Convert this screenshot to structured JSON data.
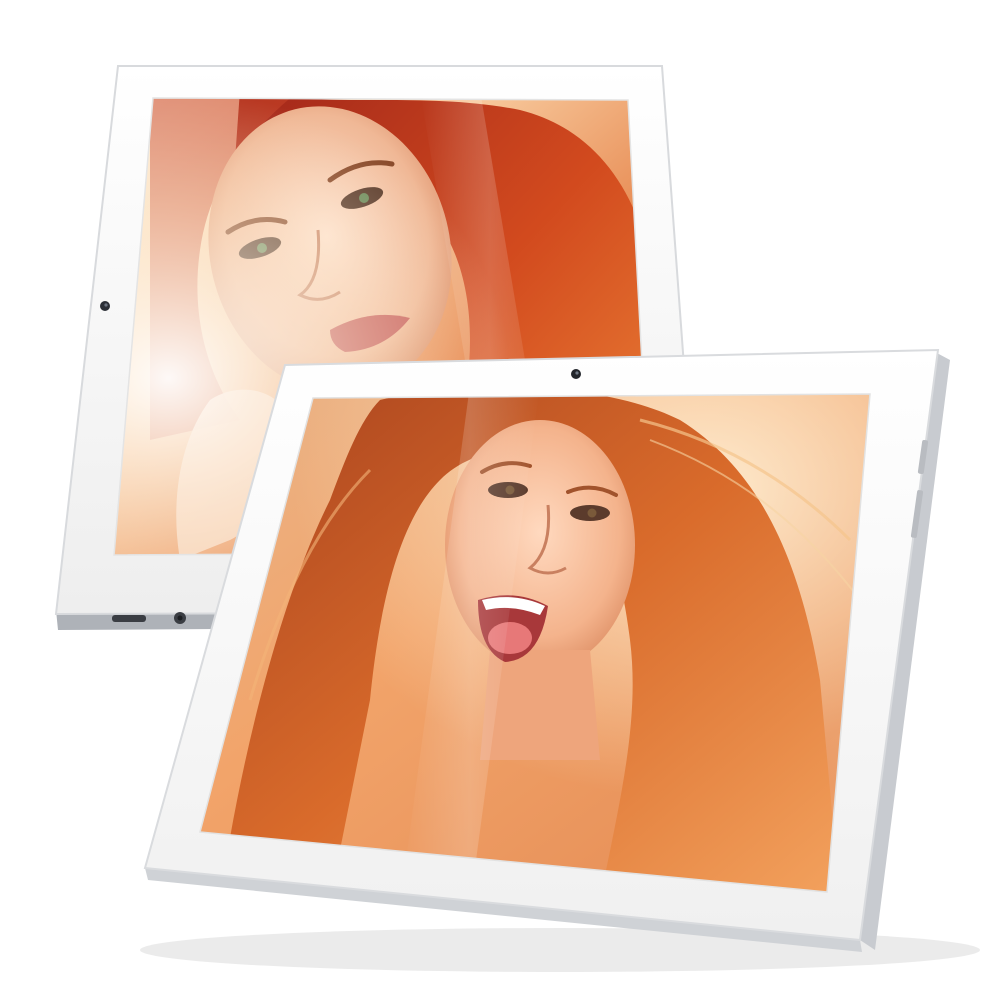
{
  "scene": {
    "background_color": "#ffffff",
    "devices": [
      {
        "role": "tablet-back",
        "orientation": "portrait",
        "bezel_color": "#f7f7f7",
        "edge_color": "#c9ccd1",
        "icons": [
          "front-camera-icon",
          "micro-usb-port-icon",
          "headphone-jack-icon"
        ]
      },
      {
        "role": "tablet-front",
        "orientation": "landscape",
        "bezel_color": "#f9f9f9",
        "edge_color": "#cfd2d6",
        "icons": [
          "front-camera-icon",
          "power-button-icon",
          "volume-button-icon"
        ]
      }
    ],
    "screen_palette": {
      "warm_highlight": "#fff3dc",
      "warm_mid": "#f0a060",
      "hair_red": "#c23a1a",
      "hair_auburn": "#d86a2a",
      "skin_tone": "#f3c6a8"
    }
  }
}
